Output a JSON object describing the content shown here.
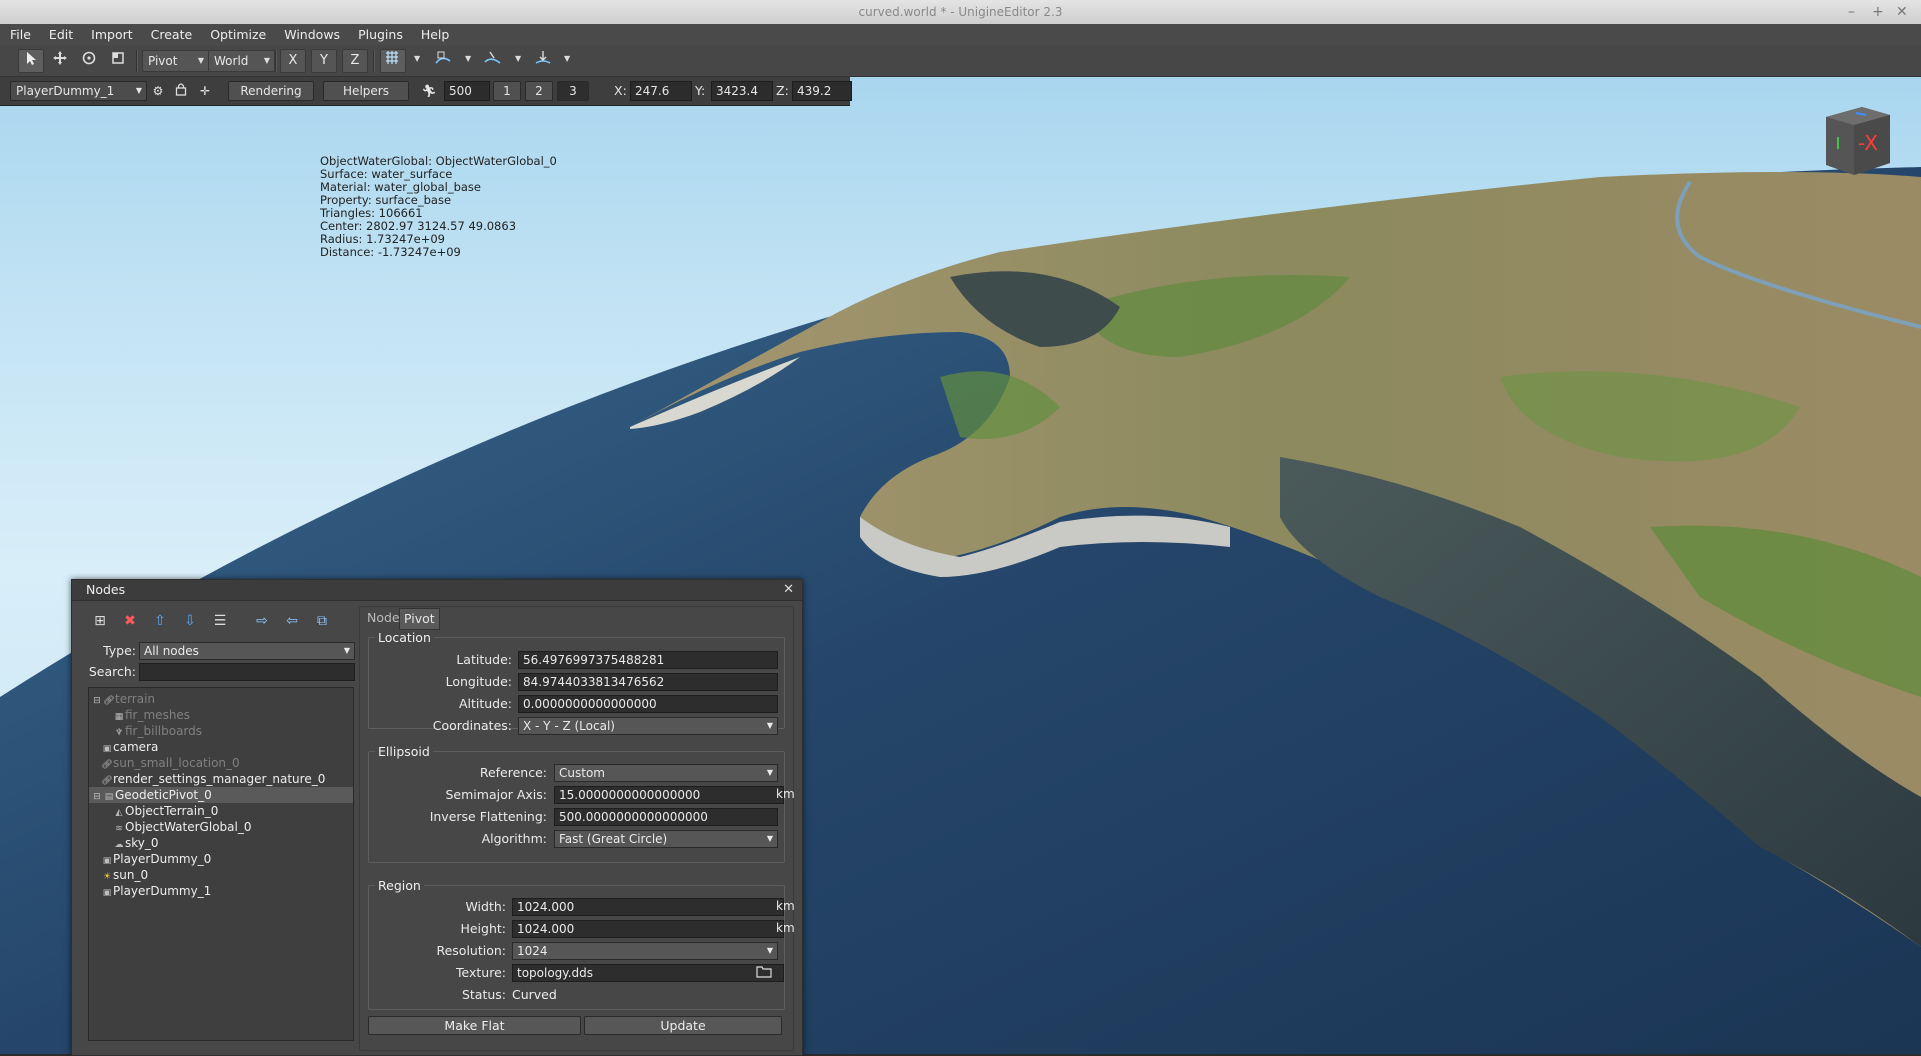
{
  "window": {
    "title": "curved.world * - UnigineEditor 2.3",
    "minimize": "–",
    "maximize": "+",
    "close": "✕"
  },
  "menu": [
    "File",
    "Edit",
    "Import",
    "Create",
    "Optimize",
    "Windows",
    "Plugins",
    "Help"
  ],
  "toolbar": {
    "pivot_mode": "Pivot",
    "space_mode": "World",
    "axis_x": "X",
    "axis_y": "Y",
    "axis_z": "Z"
  },
  "viewport_toolbar": {
    "camera": "PlayerDummy_1",
    "rendering": "Rendering",
    "helpers": "Helpers",
    "speed": "500",
    "speed_1": "1",
    "speed_2": "2",
    "speed_3": "3",
    "x_label": "X:",
    "x_value": "247.6",
    "y_label": "Y:",
    "y_value": "3423.4",
    "z_label": "Z:",
    "z_value": "439.2"
  },
  "info_overlay": [
    "ObjectWaterGlobal: ObjectWaterGlobal_0",
    "Surface: water_surface",
    "Material: water_global_base",
    "Property: surface_base",
    "Triangles: 106661",
    "Center: 2802.97 3124.57 49.0863",
    "Radius: 1.73247e+09",
    "Distance: -1.73247e+09"
  ],
  "gizmo": {
    "label": "-X"
  },
  "nodes_panel": {
    "title": "Nodes",
    "close": "✕",
    "type_label": "Type:",
    "type_value": "All nodes",
    "search_label": "Search:",
    "search_value": "",
    "tree": [
      {
        "label": "terrain",
        "dim": true
      },
      {
        "label": "fir_meshes",
        "dim": true
      },
      {
        "label": "fir_billboards",
        "dim": true
      },
      {
        "label": "camera",
        "dim": false
      },
      {
        "label": "sun_small_location_0",
        "dim": true
      },
      {
        "label": "render_settings_manager_nature_0",
        "dim": false
      },
      {
        "label": "GeodeticPivot_0",
        "dim": false
      },
      {
        "label": "ObjectTerrain_0",
        "dim": false
      },
      {
        "label": "ObjectWaterGlobal_0",
        "dim": false
      },
      {
        "label": "sky_0",
        "dim": false
      },
      {
        "label": "PlayerDummy_0",
        "dim": false
      },
      {
        "label": "sun_0",
        "dim": false
      },
      {
        "label": "PlayerDummy_1",
        "dim": false
      }
    ],
    "tabs": [
      "Node",
      "Pivot"
    ],
    "location": {
      "title": "Location",
      "latitude_label": "Latitude:",
      "latitude": "56.4976997375488281",
      "longitude_label": "Longitude:",
      "longitude": "84.9744033813476562",
      "altitude_label": "Altitude:",
      "altitude": "0.0000000000000000",
      "coordinates_label": "Coordinates:",
      "coordinates": "X - Y - Z (Local)"
    },
    "ellipsoid": {
      "title": "Ellipsoid",
      "reference_label": "Reference:",
      "reference": "Custom",
      "semimajor_label": "Semimajor Axis:",
      "semimajor": "15.0000000000000000",
      "semimajor_unit": "km",
      "flattening_label": "Inverse Flattening:",
      "flattening": "500.0000000000000000",
      "algorithm_label": "Algorithm:",
      "algorithm": "Fast (Great Circle)"
    },
    "region": {
      "title": "Region",
      "width_label": "Width:",
      "width": "1024.000",
      "width_unit": "km",
      "height_label": "Height:",
      "height": "1024.000",
      "height_unit": "km",
      "resolution_label": "Resolution:",
      "resolution": "1024",
      "texture_label": "Texture:",
      "texture": "topology.dds",
      "status_label": "Status:",
      "status": "Curved"
    },
    "make_flat": "Make Flat",
    "update": "Update"
  }
}
